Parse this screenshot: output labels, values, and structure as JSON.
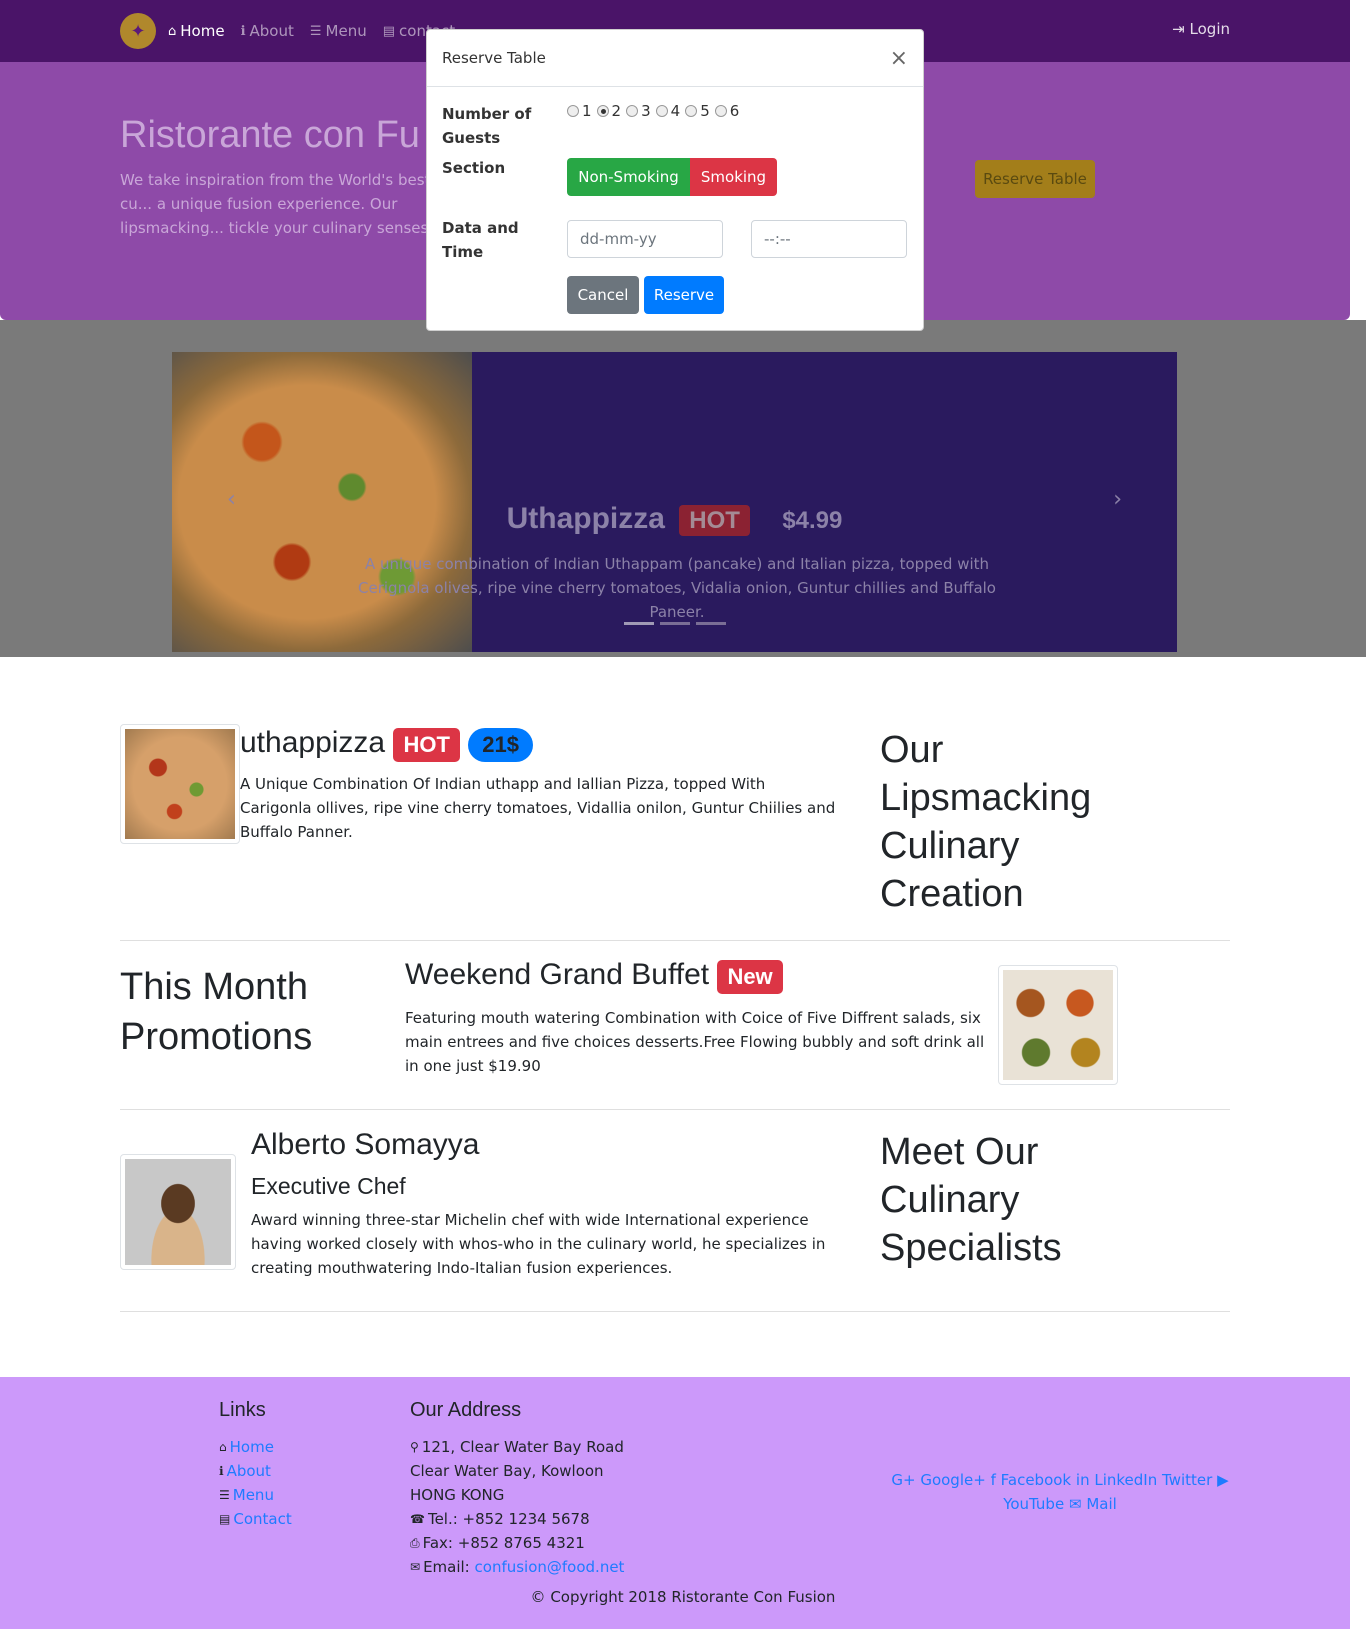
{
  "navbar": {
    "items": [
      {
        "label": "Home",
        "icon": "home-icon"
      },
      {
        "label": "About",
        "icon": "info-icon"
      },
      {
        "label": "Menu",
        "icon": "list-icon"
      },
      {
        "label": "contact",
        "icon": "address-card-icon"
      }
    ],
    "login": "Login"
  },
  "jumbotron": {
    "title": "Ristorante con Fu",
    "text": "We take inspiration from the World's best cu... a unique fusion experience. Our lipsmacking... tickle your culinary senses!",
    "button": "Reserve Table"
  },
  "carousel": {
    "title": "Uthappizza",
    "badge": "HOT",
    "price": "$4.99",
    "description": "A unique combination of Indian Uthappam (pancake) and Italian pizza, topped with Cerignola olives, ripe vine cherry tomatoes, Vidalia onion, Guntur chillies and Buffalo Paneer."
  },
  "modal": {
    "title": "Reserve Table",
    "close": "×",
    "guests_label_1": "Number of",
    "guests_label_2": "Guests",
    "guest_options": [
      "1",
      "2",
      "3",
      "4",
      "5",
      "6"
    ],
    "selected_guests": "2",
    "section_label": "Section",
    "non_smoking": "Non-Smoking",
    "smoking": "Smoking",
    "datetime_label_1": "Data and",
    "datetime_label_2": "Time",
    "date_placeholder": "dd-mm-yy",
    "time_placeholder": "--:--",
    "cancel": "Cancel",
    "reserve": "Reserve"
  },
  "dish": {
    "name": "uthappizza",
    "badge": "HOT",
    "price": "21$",
    "description": "A Unique Combination Of Indian uthapp and Iallian Pizza, topped With Carigonla ollives, ripe vine cherry tomatoes, Vidallia onilon, Guntur Chiilies and Buffalo Panner.",
    "heading": [
      "Our",
      "Lipsmacking",
      "Culinary",
      "Creation"
    ]
  },
  "promotion": {
    "heading": [
      "This Month",
      "Promotions"
    ],
    "name": "Weekend Grand Buffet",
    "badge": "New",
    "description": "Featuring mouth watering Combination with Coice of Five Diffrent salads, six main entrees and five choices desserts.Free Flowing bubbly and soft drink all in one just $19.90"
  },
  "leader": {
    "name": "Alberto Somayya",
    "designation": "Executive Chef",
    "description": "Award winning three-star Michelin chef with wide International experience having worked closely with whos-who in the culinary world, he specializes in creating mouthwatering Indo-Italian fusion experiences.",
    "heading": [
      "Meet Our",
      "Culinary",
      "Specialists"
    ]
  },
  "footer": {
    "links_title": "Links",
    "links": [
      "Home",
      "About",
      "Menu",
      "Contact"
    ],
    "address_title": "Our Address",
    "address": [
      "121, Clear Water Bay Road",
      "Clear Water Bay, Kowloon",
      "HONG KONG"
    ],
    "tel": "Tel.: +852 1234 5678",
    "fax": "Fax: +852 8765 4321",
    "email_label": "Email: ",
    "email": "confusion@food.net",
    "social": {
      "google": "Google+",
      "facebook": "Facebook",
      "linkedin": "LinkedIn",
      "twitter": "Twitter",
      "youtube": "YouTube",
      "mail": "Mail"
    },
    "copyright": "© Copyright 2018 Ristorante Con Fusion"
  },
  "colors": {
    "navbar": "#4a1468",
    "footer": "#cc99fa",
    "hot_badge": "#dc3545",
    "price_badge": "#007bff",
    "success": "#28a745"
  }
}
